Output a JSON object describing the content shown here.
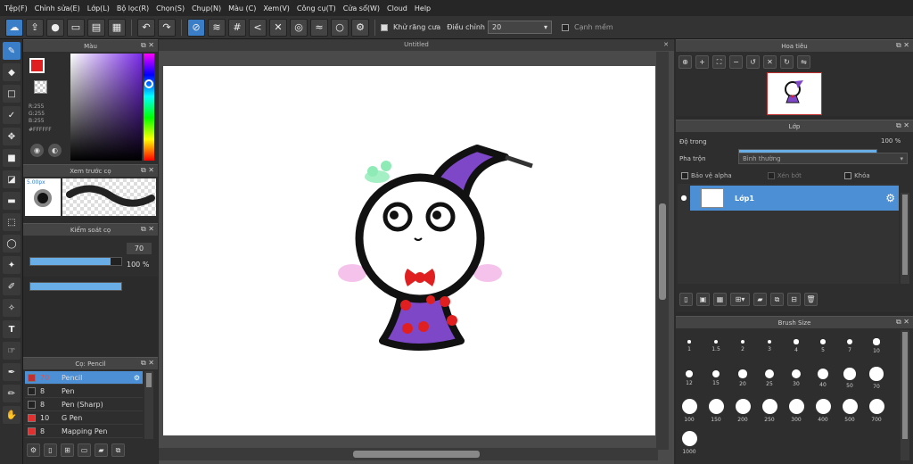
{
  "menu": [
    "Tệp(F)",
    "Chỉnh sửa(E)",
    "Lớp(L)",
    "Bộ lọc(R)",
    "Chọn(S)",
    "Chụp(N)",
    "Màu (C)",
    "Xem(V)",
    "Công cụ(T)",
    "Cửa sổ(W)",
    "Cloud",
    "Help"
  ],
  "toolbar": {
    "antialias_label": "Khử răng cưa",
    "correction_label": "Điều chỉnh",
    "correction_value": "20",
    "snap_label": "Cạnh mềm"
  },
  "color_panel": {
    "title": "Màu",
    "r": "R:255",
    "g": "G:255",
    "b": "B:255",
    "hex": "#FFFFFF"
  },
  "brush_preview": {
    "title": "Xem trước cọ",
    "size": "5.00px"
  },
  "brush_control": {
    "title": "Kiểm soát cọ",
    "size_value": "70",
    "size_fraction": 0.88,
    "opacity_value": "100 %",
    "opacity_fraction": 1.0
  },
  "brush_list": {
    "title": "Cọ: Pencil",
    "items": [
      {
        "size": "70",
        "name": "Pencil",
        "color": "#c03030",
        "selected": true
      },
      {
        "size": "8",
        "name": "Pen",
        "color": "#222222",
        "selected": false
      },
      {
        "size": "8",
        "name": "Pen (Sharp)",
        "color": "#222222",
        "selected": false
      },
      {
        "size": "10",
        "name": "G Pen",
        "color": "#e03030",
        "selected": false
      },
      {
        "size": "8",
        "name": "Mapping Pen",
        "color": "#e03030",
        "selected": false
      }
    ]
  },
  "canvas": {
    "tab_title": "Untitled"
  },
  "navigator": {
    "title": "Hoa tiêu"
  },
  "layer_panel": {
    "title": "Lớp",
    "opacity_label": "Độ trong",
    "opacity_value": "100 %",
    "opacity_fraction": 1.0,
    "blend_label": "Pha trộn",
    "blend_value": "Bình thường",
    "protect_alpha": "Bảo vệ alpha",
    "clipping": "Xén bớt",
    "lock": "Khóa",
    "layers": [
      {
        "name": "Lớp1"
      }
    ]
  },
  "brush_size": {
    "title": "Brush Size",
    "sizes": [
      "1",
      "1.5",
      "2",
      "3",
      "4",
      "5",
      "7",
      "10",
      "12",
      "15",
      "20",
      "25",
      "30",
      "40",
      "50",
      "70",
      "100",
      "150",
      "200",
      "250",
      "300",
      "400",
      "500",
      "700",
      "1000"
    ]
  },
  "colors": {
    "accent": "#3a7ec8",
    "selected_row": "#4d8fd4"
  }
}
